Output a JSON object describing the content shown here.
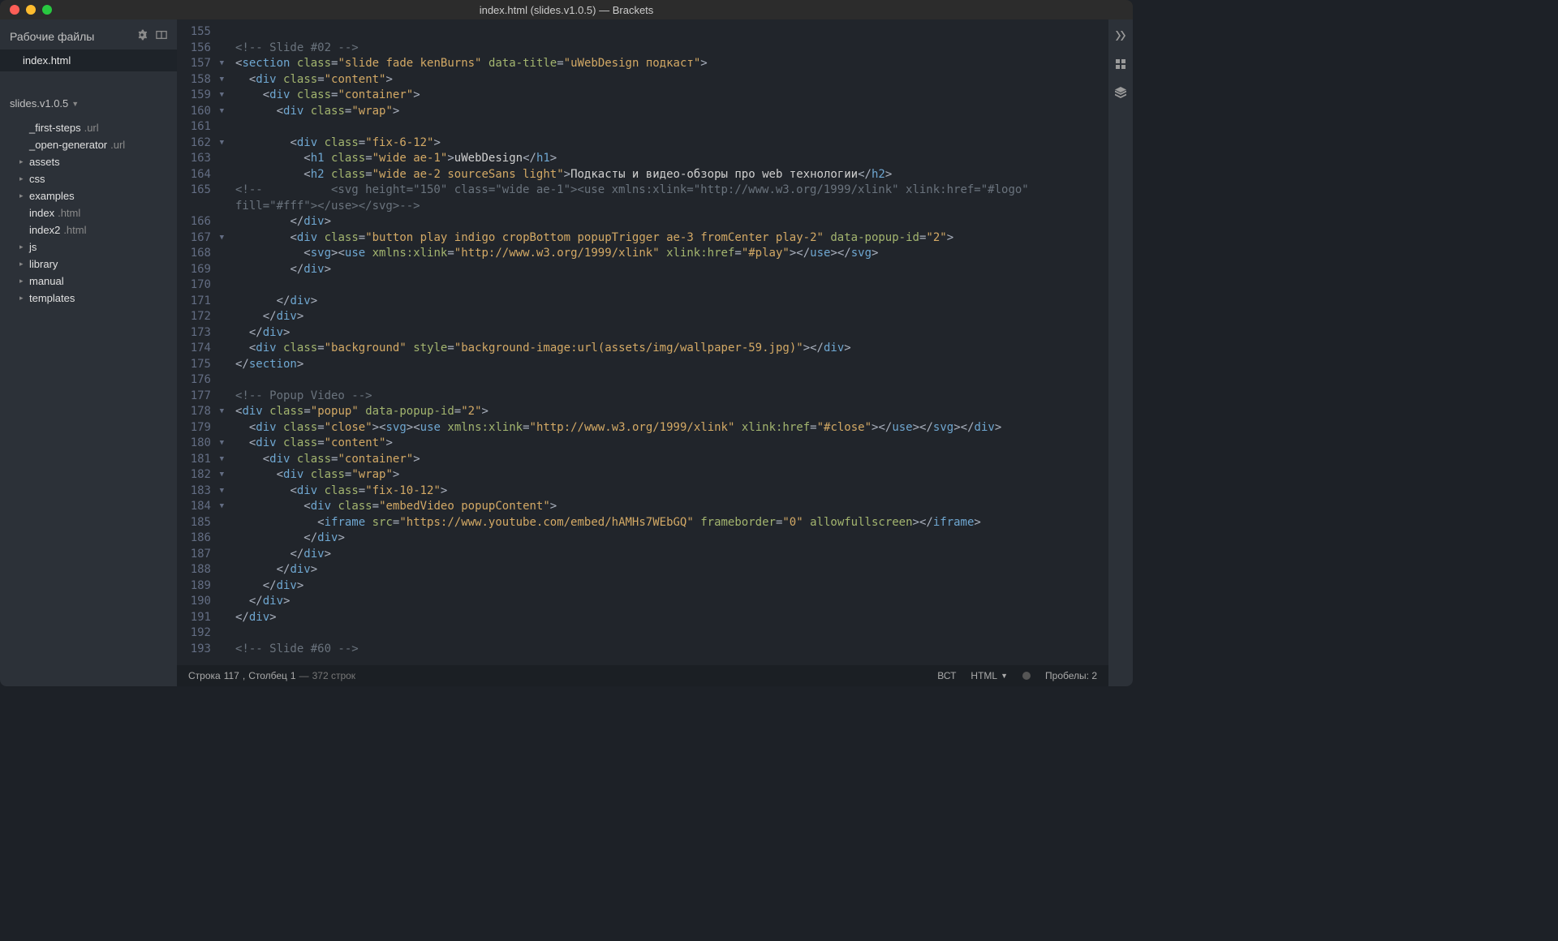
{
  "title": "index.html (slides.v1.0.5) — Brackets",
  "sidebar": {
    "header": "Рабочие файлы",
    "workingFiles": [
      {
        "name": "index",
        "ext": ".html",
        "active": true
      }
    ],
    "project": "slides.v1.0.5",
    "tree": [
      {
        "type": "file",
        "name": "_first-steps",
        "ext": ".url"
      },
      {
        "type": "file",
        "name": "_open-generator",
        "ext": ".url"
      },
      {
        "type": "folder",
        "name": "assets"
      },
      {
        "type": "folder",
        "name": "css"
      },
      {
        "type": "folder",
        "name": "examples"
      },
      {
        "type": "file",
        "name": "index",
        "ext": ".html",
        "selected": true
      },
      {
        "type": "file",
        "name": "index2",
        "ext": ".html"
      },
      {
        "type": "folder",
        "name": "js"
      },
      {
        "type": "folder",
        "name": "library"
      },
      {
        "type": "folder",
        "name": "manual"
      },
      {
        "type": "folder",
        "name": "templates"
      }
    ]
  },
  "code": [
    {
      "n": 155,
      "html": ""
    },
    {
      "n": 156,
      "html": "<span class='comment'>&lt;!-- Slide #02 --&gt;</span>"
    },
    {
      "n": 157,
      "fold": true,
      "html": "<span class='tag-bracket'>&lt;</span><span class='tag-name'>section</span> <span class='attr-name'>class</span><span class='attr-eq'>=</span><span class='attr-val'>\"slide fade kenBurns\"</span> <span class='attr-name'>data-title</span><span class='attr-eq'>=</span><span class='attr-val'>\"uWebDesign подкаст\"</span><span class='tag-bracket'>&gt;</span>"
    },
    {
      "n": 158,
      "fold": true,
      "html": "  <span class='tag-bracket'>&lt;</span><span class='tag-name'>div</span> <span class='attr-name'>class</span><span class='attr-eq'>=</span><span class='attr-val'>\"content\"</span><span class='tag-bracket'>&gt;</span>"
    },
    {
      "n": 159,
      "fold": true,
      "html": "    <span class='tag-bracket'>&lt;</span><span class='tag-name'>div</span> <span class='attr-name'>class</span><span class='attr-eq'>=</span><span class='attr-val'>\"container\"</span><span class='tag-bracket'>&gt;</span>"
    },
    {
      "n": 160,
      "fold": true,
      "html": "      <span class='tag-bracket'>&lt;</span><span class='tag-name'>div</span> <span class='attr-name'>class</span><span class='attr-eq'>=</span><span class='attr-val'>\"wrap\"</span><span class='tag-bracket'>&gt;</span>"
    },
    {
      "n": 161,
      "html": ""
    },
    {
      "n": 162,
      "fold": true,
      "html": "        <span class='tag-bracket'>&lt;</span><span class='tag-name'>div</span> <span class='attr-name'>class</span><span class='attr-eq'>=</span><span class='attr-val'>\"fix-6-12\"</span><span class='tag-bracket'>&gt;</span>"
    },
    {
      "n": 163,
      "html": "          <span class='tag-bracket'>&lt;</span><span class='tag-name'>h1</span> <span class='attr-name'>class</span><span class='attr-eq'>=</span><span class='attr-val'>\"wide ae-1\"</span><span class='tag-bracket'>&gt;</span><span class='textc'>uWebDesign</span><span class='tag-bracket'>&lt;/</span><span class='tag-name'>h1</span><span class='tag-bracket'>&gt;</span>"
    },
    {
      "n": 164,
      "html": "          <span class='tag-bracket'>&lt;</span><span class='tag-name'>h2</span> <span class='attr-name'>class</span><span class='attr-eq'>=</span><span class='attr-val'>\"wide ae-2 sourceSans light\"</span><span class='tag-bracket'>&gt;</span><span class='textc'>Подкасты и видео-обзоры про web технологии</span><span class='tag-bracket'>&lt;/</span><span class='tag-name'>h2</span><span class='tag-bracket'>&gt;</span>"
    },
    {
      "n": 165,
      "html": "<span class='comment'>&lt;!--          &lt;svg height=\"150\" class=\"wide ae-1\"&gt;&lt;use xmlns:xlink=\"http://www.w3.org/1999/xlink\" xlink:href=\"#logo\" </span>",
      "wrap": "<span class='comment'>fill=\"#fff\"&gt;&lt;/use&gt;&lt;/svg&gt;--&gt;</span>"
    },
    {
      "n": 166,
      "html": "        <span class='tag-bracket'>&lt;/</span><span class='tag-name'>div</span><span class='tag-bracket'>&gt;</span>"
    },
    {
      "n": 167,
      "fold": true,
      "html": "        <span class='tag-bracket'>&lt;</span><span class='tag-name'>div</span> <span class='attr-name'>class</span><span class='attr-eq'>=</span><span class='attr-val'>\"button play indigo cropBottom popupTrigger ae-3 fromCenter play-2\"</span> <span class='attr-name'>data-popup-id</span><span class='attr-eq'>=</span><span class='attr-val'>\"2\"</span><span class='tag-bracket'>&gt;</span>"
    },
    {
      "n": 168,
      "html": "          <span class='tag-bracket'>&lt;</span><span class='tag-name'>svg</span><span class='tag-bracket'>&gt;&lt;</span><span class='tag-name'>use</span> <span class='attr-name'>xmlns:xlink</span><span class='attr-eq'>=</span><span class='attr-val'>\"http://www.w3.org/1999/xlink\"</span> <span class='attr-name'>xlink:href</span><span class='attr-eq'>=</span><span class='attr-val'>\"#play\"</span><span class='tag-bracket'>&gt;&lt;/</span><span class='tag-name'>use</span><span class='tag-bracket'>&gt;&lt;/</span><span class='tag-name'>svg</span><span class='tag-bracket'>&gt;</span>"
    },
    {
      "n": 169,
      "html": "        <span class='tag-bracket'>&lt;/</span><span class='tag-name'>div</span><span class='tag-bracket'>&gt;</span>"
    },
    {
      "n": 170,
      "html": ""
    },
    {
      "n": 171,
      "html": "      <span class='tag-bracket'>&lt;/</span><span class='tag-name'>div</span><span class='tag-bracket'>&gt;</span>"
    },
    {
      "n": 172,
      "html": "    <span class='tag-bracket'>&lt;/</span><span class='tag-name'>div</span><span class='tag-bracket'>&gt;</span>"
    },
    {
      "n": 173,
      "html": "  <span class='tag-bracket'>&lt;/</span><span class='tag-name'>div</span><span class='tag-bracket'>&gt;</span>"
    },
    {
      "n": 174,
      "html": "  <span class='tag-bracket'>&lt;</span><span class='tag-name'>div</span> <span class='attr-name'>class</span><span class='attr-eq'>=</span><span class='attr-val'>\"background\"</span> <span class='attr-name'>style</span><span class='attr-eq'>=</span><span class='attr-val'>\"background-image:url(assets/img/wallpaper-59.jpg)\"</span><span class='tag-bracket'>&gt;&lt;/</span><span class='tag-name'>div</span><span class='tag-bracket'>&gt;</span>"
    },
    {
      "n": 175,
      "html": "<span class='tag-bracket'>&lt;/</span><span class='tag-name'>section</span><span class='tag-bracket'>&gt;</span>"
    },
    {
      "n": 176,
      "html": ""
    },
    {
      "n": 177,
      "html": "<span class='comment'>&lt;!-- Popup Video --&gt;</span>"
    },
    {
      "n": 178,
      "fold": true,
      "html": "<span class='tag-bracket'>&lt;</span><span class='tag-name'>div</span> <span class='attr-name'>class</span><span class='attr-eq'>=</span><span class='attr-val'>\"popup\"</span> <span class='attr-name'>data-popup-id</span><span class='attr-eq'>=</span><span class='attr-val'>\"2\"</span><span class='tag-bracket'>&gt;</span>"
    },
    {
      "n": 179,
      "html": "  <span class='tag-bracket'>&lt;</span><span class='tag-name'>div</span> <span class='attr-name'>class</span><span class='attr-eq'>=</span><span class='attr-val'>\"close\"</span><span class='tag-bracket'>&gt;&lt;</span><span class='tag-name'>svg</span><span class='tag-bracket'>&gt;&lt;</span><span class='tag-name'>use</span> <span class='attr-name'>xmlns:xlink</span><span class='attr-eq'>=</span><span class='attr-val'>\"http://www.w3.org/1999/xlink\"</span> <span class='attr-name'>xlink:href</span><span class='attr-eq'>=</span><span class='attr-val'>\"#close\"</span><span class='tag-bracket'>&gt;&lt;/</span><span class='tag-name'>use</span><span class='tag-bracket'>&gt;&lt;/</span><span class='tag-name'>svg</span><span class='tag-bracket'>&gt;&lt;/</span><span class='tag-name'>div</span><span class='tag-bracket'>&gt;</span>"
    },
    {
      "n": 180,
      "fold": true,
      "html": "  <span class='tag-bracket'>&lt;</span><span class='tag-name'>div</span> <span class='attr-name'>class</span><span class='attr-eq'>=</span><span class='attr-val'>\"content\"</span><span class='tag-bracket'>&gt;</span>"
    },
    {
      "n": 181,
      "fold": true,
      "html": "    <span class='tag-bracket'>&lt;</span><span class='tag-name'>div</span> <span class='attr-name'>class</span><span class='attr-eq'>=</span><span class='attr-val'>\"container\"</span><span class='tag-bracket'>&gt;</span>"
    },
    {
      "n": 182,
      "fold": true,
      "html": "      <span class='tag-bracket'>&lt;</span><span class='tag-name'>div</span> <span class='attr-name'>class</span><span class='attr-eq'>=</span><span class='attr-val'>\"wrap\"</span><span class='tag-bracket'>&gt;</span>"
    },
    {
      "n": 183,
      "fold": true,
      "html": "        <span class='tag-bracket'>&lt;</span><span class='tag-name'>div</span> <span class='attr-name'>class</span><span class='attr-eq'>=</span><span class='attr-val'>\"fix-10-12\"</span><span class='tag-bracket'>&gt;</span>"
    },
    {
      "n": 184,
      "fold": true,
      "html": "          <span class='tag-bracket'>&lt;</span><span class='tag-name'>div</span> <span class='attr-name'>class</span><span class='attr-eq'>=</span><span class='attr-val'>\"embedVideo popupContent\"</span><span class='tag-bracket'>&gt;</span>"
    },
    {
      "n": 185,
      "html": "            <span class='tag-bracket'>&lt;</span><span class='tag-name'>iframe</span> <span class='attr-name'>src</span><span class='attr-eq'>=</span><span class='attr-val'>\"https://www.youtube.com/embed/hAMHs7WEbGQ\"</span> <span class='attr-name'>frameborder</span><span class='attr-eq'>=</span><span class='attr-val'>\"0\"</span> <span class='attr-name'>allowfullscreen</span><span class='tag-bracket'>&gt;&lt;/</span><span class='tag-name'>iframe</span><span class='tag-bracket'>&gt;</span>"
    },
    {
      "n": 186,
      "html": "          <span class='tag-bracket'>&lt;/</span><span class='tag-name'>div</span><span class='tag-bracket'>&gt;</span>"
    },
    {
      "n": 187,
      "html": "        <span class='tag-bracket'>&lt;/</span><span class='tag-name'>div</span><span class='tag-bracket'>&gt;</span>"
    },
    {
      "n": 188,
      "html": "      <span class='tag-bracket'>&lt;/</span><span class='tag-name'>div</span><span class='tag-bracket'>&gt;</span>"
    },
    {
      "n": 189,
      "html": "    <span class='tag-bracket'>&lt;/</span><span class='tag-name'>div</span><span class='tag-bracket'>&gt;</span>"
    },
    {
      "n": 190,
      "html": "  <span class='tag-bracket'>&lt;/</span><span class='tag-name'>div</span><span class='tag-bracket'>&gt;</span>"
    },
    {
      "n": 191,
      "html": "<span class='tag-bracket'>&lt;/</span><span class='tag-name'>div</span><span class='tag-bracket'>&gt;</span>"
    },
    {
      "n": 192,
      "html": ""
    },
    {
      "n": 193,
      "html": "<span class='comment'>&lt;!-- Slide #60 --&gt;</span>"
    }
  ],
  "status": {
    "line_label": "Строка",
    "line": "117",
    "col_label": "Столбец",
    "col": "1",
    "total": "372 строк",
    "ins": "ВСТ",
    "lang": "HTML",
    "spaces_label": "Пробелы:",
    "spaces": "2"
  }
}
